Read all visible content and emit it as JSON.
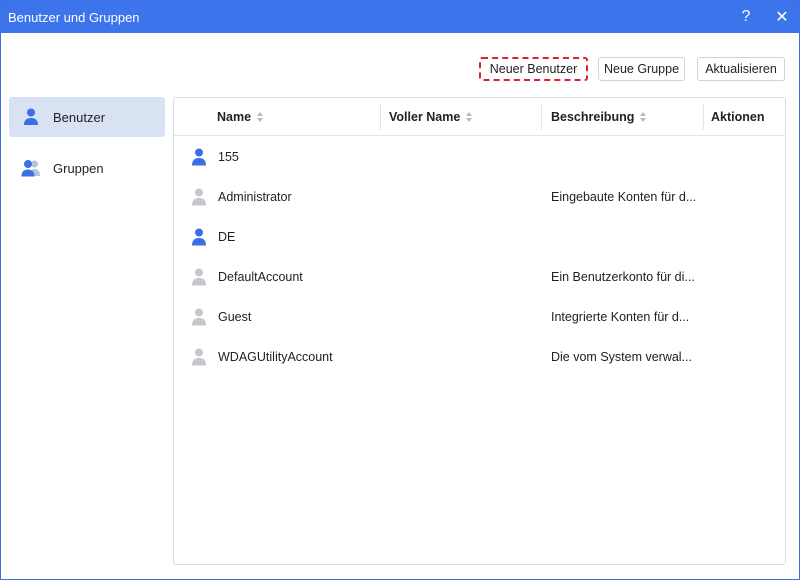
{
  "window": {
    "title": "Benutzer und Gruppen",
    "help_label": "?",
    "close_label": "✕"
  },
  "toolbar": {
    "new_user_label": "Neuer Benutzer",
    "new_group_label": "Neue Gruppe",
    "refresh_label": "Aktualisieren"
  },
  "sidebar": {
    "items": [
      {
        "label": "Benutzer",
        "icon": "user-icon",
        "active": true
      },
      {
        "label": "Gruppen",
        "icon": "group-icon",
        "active": false
      }
    ]
  },
  "table": {
    "columns": [
      "Name",
      "Voller Name",
      "Beschreibung",
      "Aktionen"
    ],
    "rows": [
      {
        "name": "155",
        "full_name": "",
        "description": "",
        "icon": "user-active-icon"
      },
      {
        "name": "Administrator",
        "full_name": "",
        "description": "Eingebaute Konten für d...",
        "icon": "user-disabled-icon"
      },
      {
        "name": "DE",
        "full_name": "",
        "description": "",
        "icon": "user-active-icon"
      },
      {
        "name": "DefaultAccount",
        "full_name": "",
        "description": "Ein Benutzerkonto für di...",
        "icon": "user-disabled-icon"
      },
      {
        "name": "Guest",
        "full_name": "",
        "description": "Integrierte Konten für d...",
        "icon": "user-disabled-icon"
      },
      {
        "name": "WDAGUtilityAccount",
        "full_name": "",
        "description": "Die vom System verwal...",
        "icon": "user-disabled-icon"
      }
    ]
  },
  "colors": {
    "titlebar": "#3c74ec",
    "active_user": "#3b6fe6",
    "disabled_user": "#c4c7cc",
    "highlight": "#e0202a"
  }
}
